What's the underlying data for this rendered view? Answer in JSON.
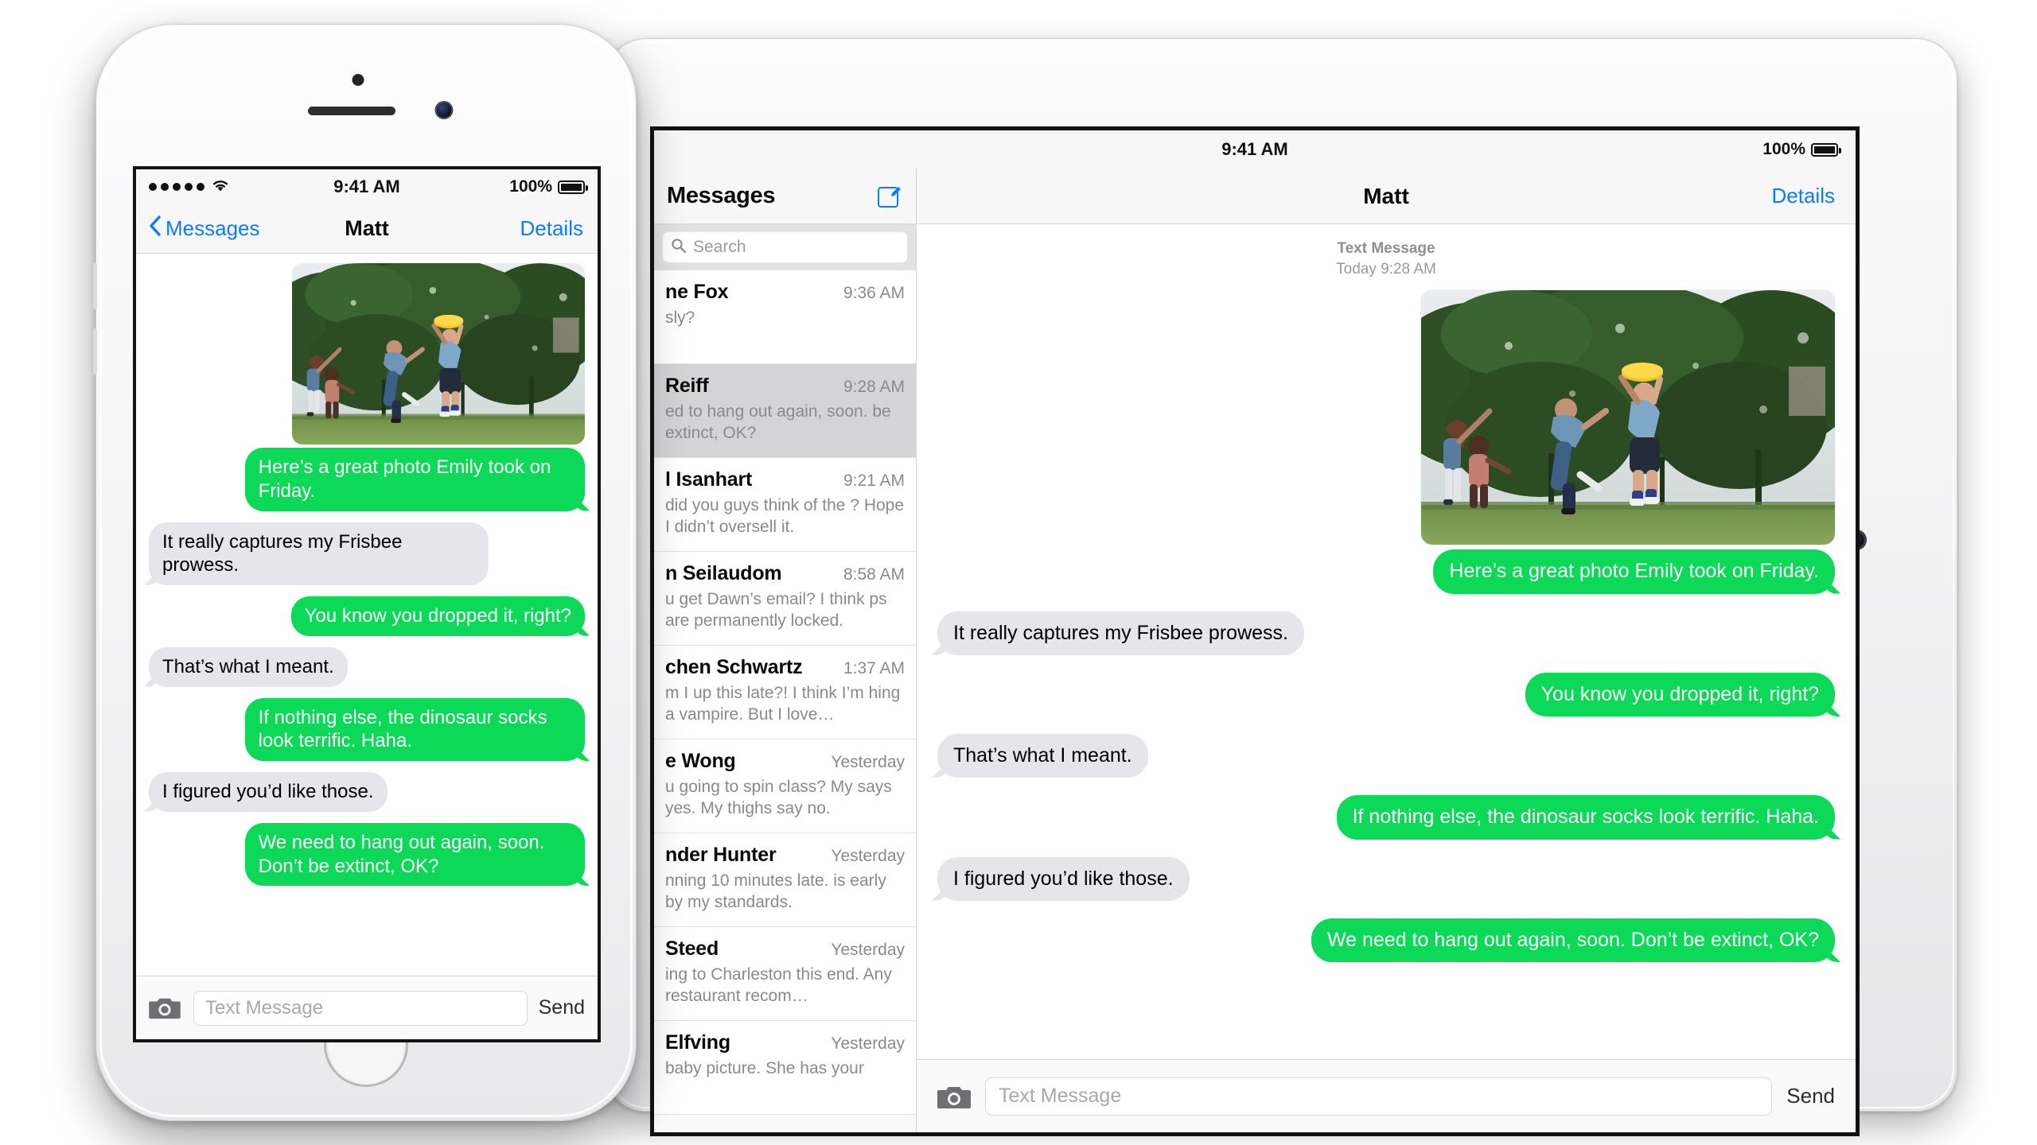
{
  "iphone": {
    "device_name": "iPhone",
    "status": {
      "signal": "•••••",
      "wifi": "wifi-icon",
      "time": "9:41 AM",
      "battery": "100%"
    },
    "nav": {
      "back_label": "Messages",
      "title": "Matt",
      "details_label": "Details"
    },
    "thread": {
      "photo_alt": "Friends playing ultimate frisbee in a park",
      "messages": [
        {
          "side": "out",
          "text": "Here’s a great photo Emily took on Friday."
        },
        {
          "side": "in",
          "text": "It really captures my Frisbee prowess."
        },
        {
          "side": "out",
          "text": "You know you dropped it, right?"
        },
        {
          "side": "in",
          "text": "That’s what I meant."
        },
        {
          "side": "out",
          "text": "If nothing else, the dinosaur socks look terrific. Haha."
        },
        {
          "side": "in",
          "text": "I figured you’d like those."
        },
        {
          "side": "out",
          "text": "We need to hang out again, soon. Don’t be extinct, OK?"
        }
      ]
    },
    "composer": {
      "camera_icon": "camera-icon",
      "placeholder": "Text Message",
      "send_label": "Send"
    }
  },
  "ipad": {
    "device_name": "iPad",
    "status": {
      "time": "9:41 AM",
      "battery": "100%"
    },
    "list": {
      "title": "Messages",
      "compose_icon": "compose-icon",
      "search": {
        "icon": "search-icon",
        "placeholder": "Search"
      },
      "conversations": [
        {
          "name": "ne Fox",
          "time": "9:36 AM",
          "snippet": "sly?",
          "selected": false
        },
        {
          "name": "Reiff",
          "time": "9:28 AM",
          "snippet": "ed to hang out again, soon. be extinct, OK?",
          "selected": true
        },
        {
          "name": "l Isanhart",
          "time": "9:21 AM",
          "snippet": "did you guys think of the ? Hope I didn’t oversell it.",
          "selected": false
        },
        {
          "name": "n Seilaudom",
          "time": "8:58 AM",
          "snippet": "u get Dawn’s email? I think ps are permanently locked.",
          "selected": false
        },
        {
          "name": "chen Schwartz",
          "time": "1:37 AM",
          "snippet": "m I up this late?! I think I’m hing a vampire. But I love…",
          "selected": false
        },
        {
          "name": "e Wong",
          "time": "Yesterday",
          "snippet": "u going to spin class? My says yes. My thighs say no.",
          "selected": false
        },
        {
          "name": "nder Hunter",
          "time": "Yesterday",
          "snippet": "nning 10 minutes late. is early by my standards.",
          "selected": false
        },
        {
          "name": "Steed",
          "time": "Yesterday",
          "snippet": "ing to Charleston this end. Any restaurant recom…",
          "selected": false
        },
        {
          "name": "Elfving",
          "time": "Yesterday",
          "snippet": "baby picture. She has your",
          "selected": false
        }
      ]
    },
    "detail": {
      "title": "Matt",
      "details_label": "Details",
      "stamp_kind": "Text Message",
      "stamp_time": "Today 9:28 AM",
      "photo_alt": "Friends playing ultimate frisbee in a park",
      "messages": [
        {
          "side": "out",
          "text": "Here’s a great photo Emily took on Friday."
        },
        {
          "side": "in",
          "text": "It really captures my Frisbee prowess."
        },
        {
          "side": "out",
          "text": "You know you dropped it, right?"
        },
        {
          "side": "in",
          "text": "That’s what I meant."
        },
        {
          "side": "out",
          "text": "If nothing else, the dinosaur socks look terrific. Haha."
        },
        {
          "side": "in",
          "text": "I figured you’d like those."
        },
        {
          "side": "out",
          "text": "We need to hang out again, soon. Don’t be extinct, OK?"
        }
      ],
      "composer": {
        "camera_icon": "camera-icon",
        "placeholder": "Text Message",
        "send_label": "Send"
      }
    }
  },
  "colors": {
    "imessage_green": "#0bd957",
    "incoming_grey": "#e5e5ea",
    "link_blue": "#0a7cff",
    "chrome_grey": "#f7f7f7",
    "selected_row": "#d4d4d6"
  }
}
